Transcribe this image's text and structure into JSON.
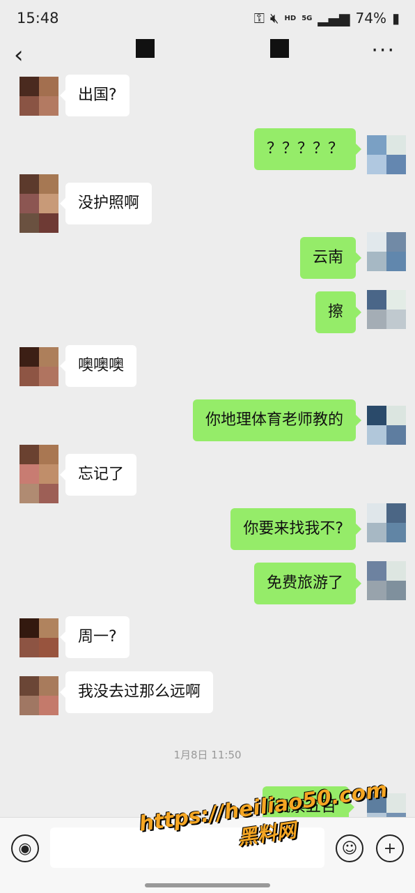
{
  "status_bar": {
    "time": "15:48",
    "network": "HD",
    "signal_label": "5G",
    "battery": "74%"
  },
  "nav": {
    "back_icon": "chevron-left",
    "more_icon": "more-horizontal"
  },
  "messages": [
    {
      "from": "contact",
      "text": "出国?"
    },
    {
      "from": "me",
      "text": "？？？？？"
    },
    {
      "from": "contact",
      "text": "没护照啊"
    },
    {
      "from": "me",
      "text": "云南"
    },
    {
      "from": "me",
      "text": "擦"
    },
    {
      "from": "contact",
      "text": "噢噢噢"
    },
    {
      "from": "me",
      "text": "你地理体育老师教的"
    },
    {
      "from": "contact",
      "text": "忘记了"
    },
    {
      "from": "me",
      "text": "你要来找我不?"
    },
    {
      "from": "me",
      "text": "免费旅游了"
    },
    {
      "from": "contact",
      "text": "周一?"
    },
    {
      "from": "contact",
      "text": "我没去过那么远啊"
    },
    {
      "from": "me",
      "text": "机票五百"
    }
  ],
  "timestamp": "1月8日 11:50",
  "composer": {
    "voice_icon": "voice-icon",
    "emoji_icon": "emoji-icon",
    "plus_icon": "plus-icon"
  },
  "watermark": {
    "line1": "https://heiliao50.com",
    "line2": "黑料网"
  },
  "colors": {
    "bg": "#ededed",
    "out_bubble": "#95ec69",
    "in_bubble": "#ffffff"
  }
}
